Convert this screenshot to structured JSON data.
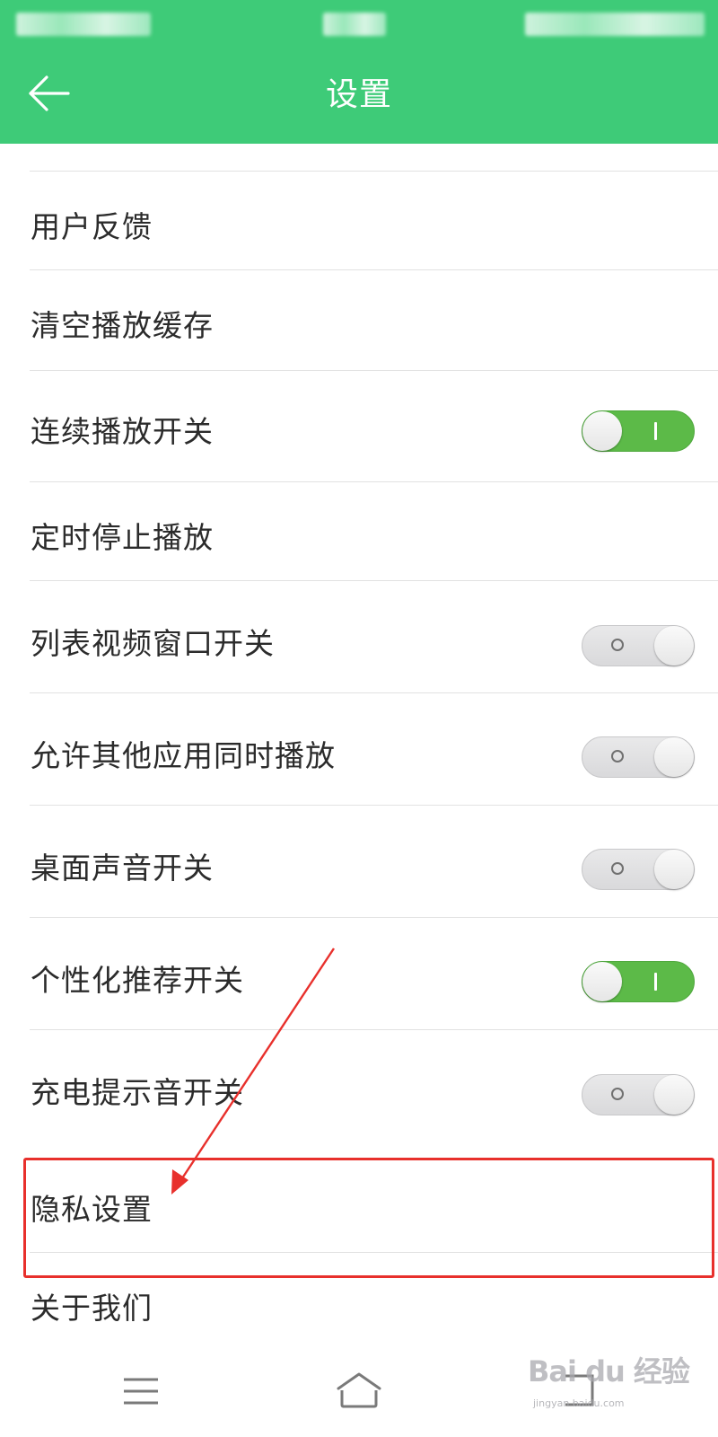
{
  "app": {
    "title": "设置",
    "accent_color": "#3ecb78",
    "toggle_on_color": "#5cba48",
    "annotation_color": "#e8302c"
  },
  "header": {
    "back_icon": "arrow-left-icon",
    "title": "设置"
  },
  "settings": {
    "items": [
      {
        "label": "用户反馈"
      },
      {
        "label": "清空播放缓存"
      },
      {
        "label": "连续播放开关",
        "toggle": "on"
      },
      {
        "label": "定时停止播放"
      },
      {
        "label": "列表视频窗口开关",
        "toggle": "off"
      },
      {
        "label": "允许其他应用同时播放",
        "toggle": "off"
      },
      {
        "label": "桌面声音开关",
        "toggle": "off"
      },
      {
        "label": "个性化推荐开关",
        "toggle": "on"
      },
      {
        "label": "充电提示音开关",
        "toggle": "off"
      },
      {
        "label": "隐私设置",
        "highlighted": true
      },
      {
        "label": "关于我们"
      }
    ]
  },
  "bottom_nav": {
    "icons": [
      "menu-icon",
      "home-icon",
      "back-nav-icon"
    ]
  },
  "watermark": {
    "logo": "Bai du 经验",
    "url": "jingyan.baidu.com"
  }
}
